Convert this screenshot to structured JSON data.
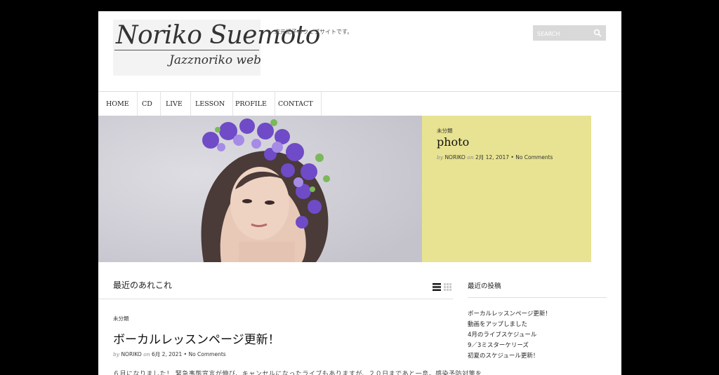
{
  "header": {
    "logo_line1": "Noriko Suemoto",
    "logo_line2": "Jazznoriko web",
    "tagline": "末元紀子のウェブサイトです。",
    "search_placeholder": "SEARCH"
  },
  "nav": [
    "HOME",
    "CD",
    "LIVE",
    "LESSON",
    "PROFILE",
    "CONTACT"
  ],
  "hero": {
    "category": "未分類",
    "title": "photo",
    "by": "by",
    "author": "NORIKO",
    "on": "on",
    "date": "2月 12, 2017",
    "comments": "No Comments"
  },
  "main": {
    "section_title": "最近のあれこれ",
    "post": {
      "category": "未分類",
      "title": "ボーカルレッスンページ更新！",
      "by": "by",
      "author": "NORIKO",
      "on": "on",
      "date": "6月 2, 2021",
      "comments": "No Comments",
      "excerpt": "６月になりました！ 緊急事態宣言が伸び、キャンセルになったライブもありますが、２０日まであと一息。感染予防対策を"
    }
  },
  "sidebar": {
    "title": "最近の投稿",
    "items": [
      "ボーカルレッスンページ更新！",
      "動画をアップしました",
      "4月のライブスケジュール",
      "9／3ミスターケリーズ",
      "初夏のスケジュール更新！"
    ]
  },
  "colors": {
    "hero_panel": "#e8e392",
    "background": "#000000",
    "page": "#ffffff"
  }
}
